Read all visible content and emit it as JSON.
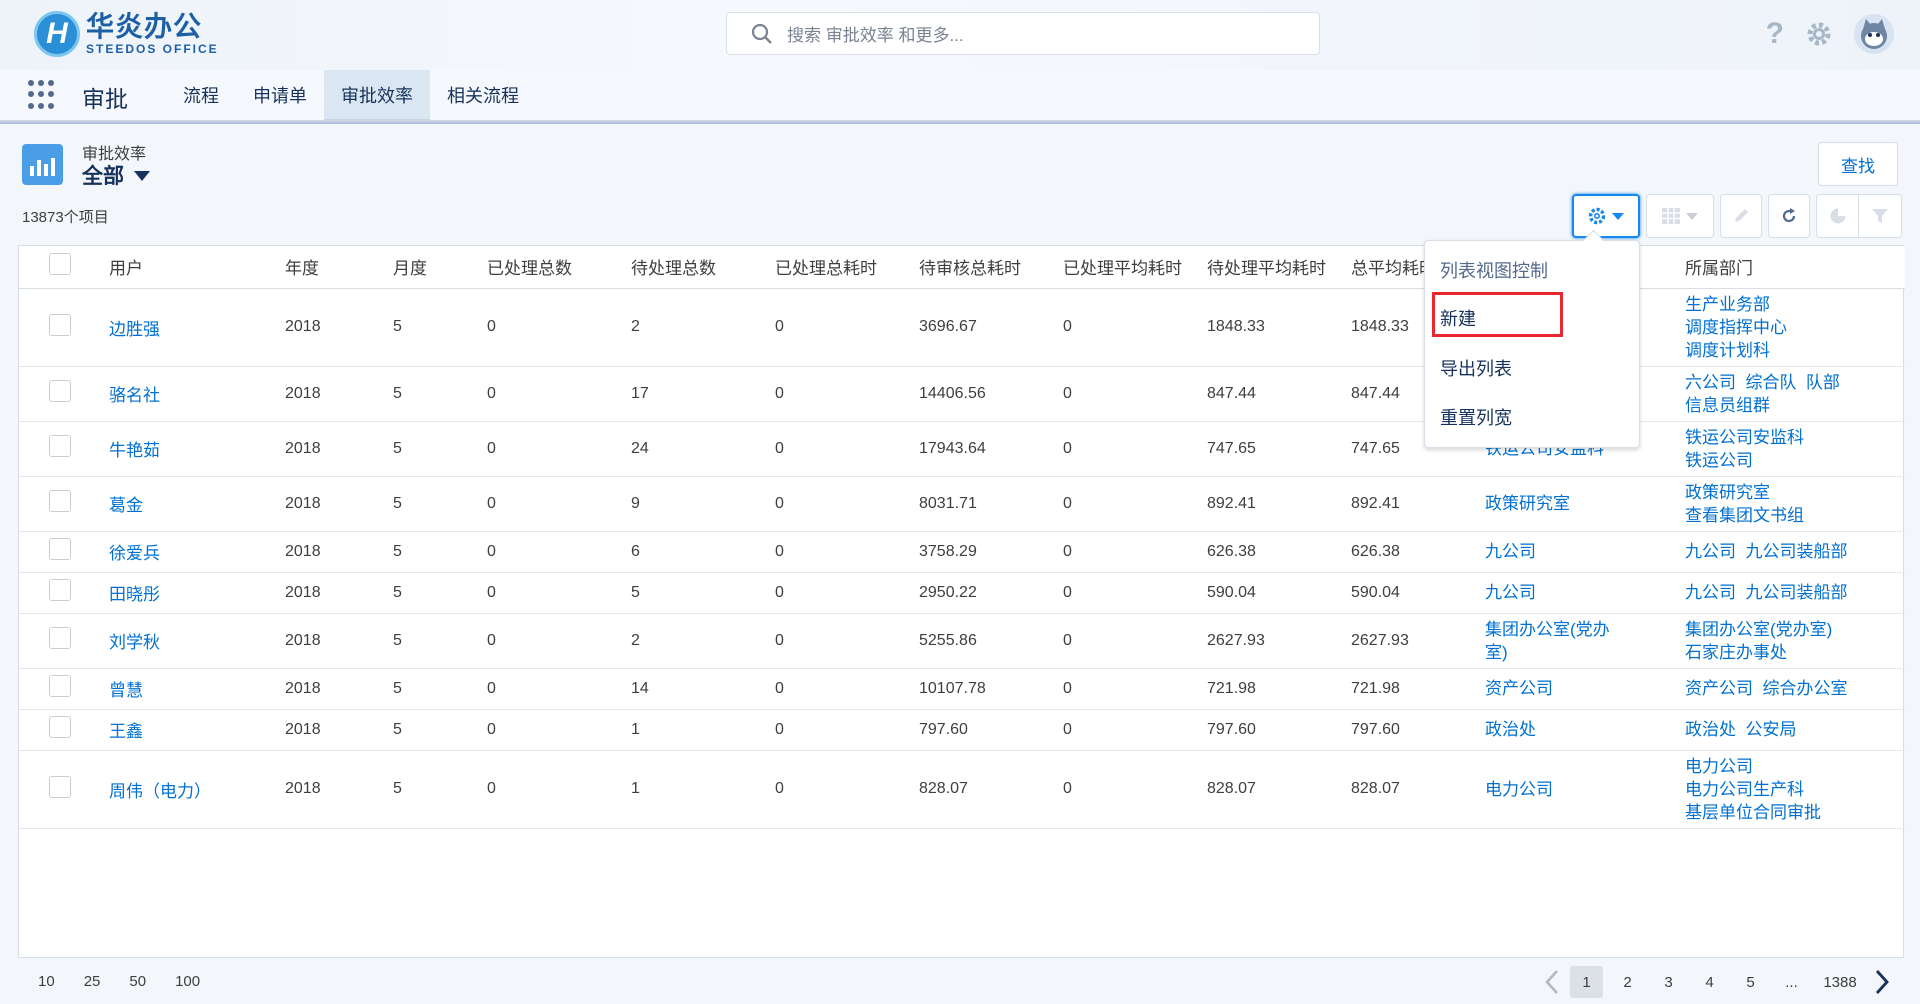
{
  "header": {
    "logo_cn": "华炎办公",
    "logo_en": "STEEDOS OFFICE",
    "search_placeholder": "搜索 审批效率 和更多..."
  },
  "nav": {
    "app_name": "审批",
    "tabs": [
      {
        "label": "流程"
      },
      {
        "label": "申请单"
      },
      {
        "label": "审批效率"
      },
      {
        "label": "相关流程"
      }
    ]
  },
  "list": {
    "object_name": "审批效率",
    "view_name": "全部",
    "item_count": "13873个项目",
    "find_label": "查找"
  },
  "columns": [
    "用户",
    "年度",
    "月度",
    "已处理总数",
    "待处理总数",
    "已处理总耗时",
    "待审核总耗时",
    "已处理平均耗时",
    "待处理平均耗时",
    "总平均耗时",
    "",
    "所属部门"
  ],
  "rows": [
    {
      "user": "边胜强",
      "year": "2018",
      "month": "5",
      "done": "0",
      "pending": "2",
      "done_time": "0",
      "pending_time": "3696.67",
      "done_avg": "0",
      "pending_avg": "1848.33",
      "avg": "1848.33",
      "org": [],
      "dept": [
        "生产业务部",
        "调度指挥中心",
        "调度计划科"
      ]
    },
    {
      "user": "骆名社",
      "year": "2018",
      "month": "5",
      "done": "0",
      "pending": "17",
      "done_time": "0",
      "pending_time": "14406.56",
      "done_avg": "0",
      "pending_avg": "847.44",
      "avg": "847.44",
      "org": [],
      "dept": [
        "六公司  综合队  队部",
        "信息员组群"
      ]
    },
    {
      "user": "牛艳茹",
      "year": "2018",
      "month": "5",
      "done": "0",
      "pending": "24",
      "done_time": "0",
      "pending_time": "17943.64",
      "done_avg": "0",
      "pending_avg": "747.65",
      "avg": "747.65",
      "org": [
        "铁运公司安监科"
      ],
      "dept": [
        "铁运公司安监科",
        "铁运公司"
      ]
    },
    {
      "user": "葛金",
      "year": "2018",
      "month": "5",
      "done": "0",
      "pending": "9",
      "done_time": "0",
      "pending_time": "8031.71",
      "done_avg": "0",
      "pending_avg": "892.41",
      "avg": "892.41",
      "org": [
        "政策研究室"
      ],
      "dept": [
        "政策研究室",
        "查看集团文书组"
      ]
    },
    {
      "user": "徐爱兵",
      "year": "2018",
      "month": "5",
      "done": "0",
      "pending": "6",
      "done_time": "0",
      "pending_time": "3758.29",
      "done_avg": "0",
      "pending_avg": "626.38",
      "avg": "626.38",
      "org": [
        "九公司"
      ],
      "dept": [
        "九公司  九公司装船部"
      ]
    },
    {
      "user": "田晓彤",
      "year": "2018",
      "month": "5",
      "done": "0",
      "pending": "5",
      "done_time": "0",
      "pending_time": "2950.22",
      "done_avg": "0",
      "pending_avg": "590.04",
      "avg": "590.04",
      "org": [
        "九公司"
      ],
      "dept": [
        "九公司  九公司装船部"
      ]
    },
    {
      "user": "刘学秋",
      "year": "2018",
      "month": "5",
      "done": "0",
      "pending": "2",
      "done_time": "0",
      "pending_time": "5255.86",
      "done_avg": "0",
      "pending_avg": "2627.93",
      "avg": "2627.93",
      "org": [
        "集团办公室(党办",
        "室)"
      ],
      "dept": [
        "集团办公室(党办室)",
        "石家庄办事处"
      ]
    },
    {
      "user": "曾慧",
      "year": "2018",
      "month": "5",
      "done": "0",
      "pending": "14",
      "done_time": "0",
      "pending_time": "10107.78",
      "done_avg": "0",
      "pending_avg": "721.98",
      "avg": "721.98",
      "org": [
        "资产公司"
      ],
      "dept": [
        "资产公司  综合办公室"
      ]
    },
    {
      "user": "王鑫",
      "year": "2018",
      "month": "5",
      "done": "0",
      "pending": "1",
      "done_time": "0",
      "pending_time": "797.60",
      "done_avg": "0",
      "pending_avg": "797.60",
      "avg": "797.60",
      "org": [
        "政治处"
      ],
      "dept": [
        "政治处  公安局"
      ]
    },
    {
      "user": "周伟（电力）",
      "year": "2018",
      "month": "5",
      "done": "0",
      "pending": "1",
      "done_time": "0",
      "pending_time": "828.07",
      "done_avg": "0",
      "pending_avg": "828.07",
      "avg": "828.07",
      "org": [
        "电力公司"
      ],
      "dept": [
        "电力公司",
        "电力公司生产科",
        "基层单位合同审批"
      ]
    }
  ],
  "menu": {
    "heading": "列表视图控制",
    "items": [
      "新建",
      "导出列表",
      "重置列宽"
    ]
  },
  "footer": {
    "page_sizes": [
      "10",
      "25",
      "50",
      "100"
    ],
    "pages": [
      "1",
      "2",
      "3",
      "4",
      "5",
      "...",
      "1388"
    ],
    "current_page": "1"
  },
  "colors": {
    "link": "#0070d2",
    "accent": "#1589ee",
    "highlight_box": "#e8272e"
  }
}
